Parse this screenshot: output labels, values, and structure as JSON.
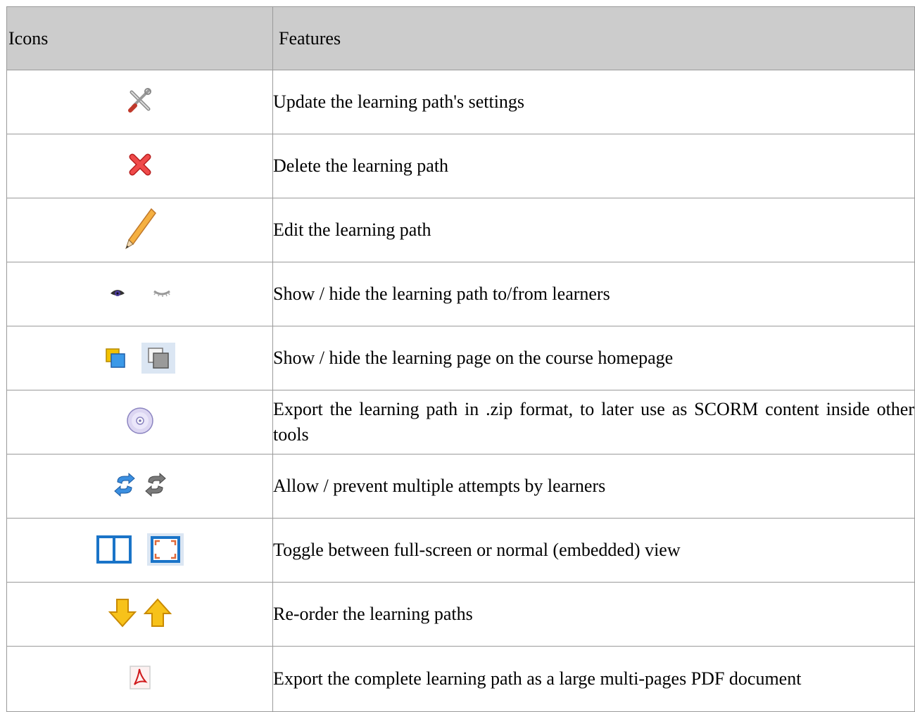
{
  "table": {
    "headers": {
      "icons": "Icons",
      "features": "Features"
    },
    "rows": [
      {
        "feature": "Update the learning path's settings",
        "icons": [
          "tools-icon"
        ]
      },
      {
        "feature": "Delete the learning path",
        "icons": [
          "delete-x-icon"
        ]
      },
      {
        "feature": "Edit  the learning path",
        "icons": [
          "pencil-icon"
        ]
      },
      {
        "feature": "Show / hide the learning path to/from learners",
        "icons": [
          "visible-eye-icon",
          "invisible-eye-icon"
        ]
      },
      {
        "feature": "Show / hide the learning page on  the course homepage",
        "icons": [
          "shared-page-icon",
          "unshared-page-icon"
        ]
      },
      {
        "feature": "Export the learning path in .zip format, to later use as SCORM content inside other tools",
        "icons": [
          "cd-export-icon"
        ]
      },
      {
        "feature": "Allow / prevent multiple attempts by learners",
        "icons": [
          "reload-active-icon",
          "reload-inactive-icon"
        ]
      },
      {
        "feature": "Toggle between full-screen or normal (embedded) view",
        "icons": [
          "split-view-icon",
          "fullscreen-view-icon"
        ]
      },
      {
        "feature": "Re-order the learning paths",
        "icons": [
          "arrow-down-icon",
          "arrow-up-icon"
        ]
      },
      {
        "feature": "Export the complete learning path as a large multi-pages PDF document",
        "icons": [
          "pdf-icon"
        ]
      }
    ]
  }
}
